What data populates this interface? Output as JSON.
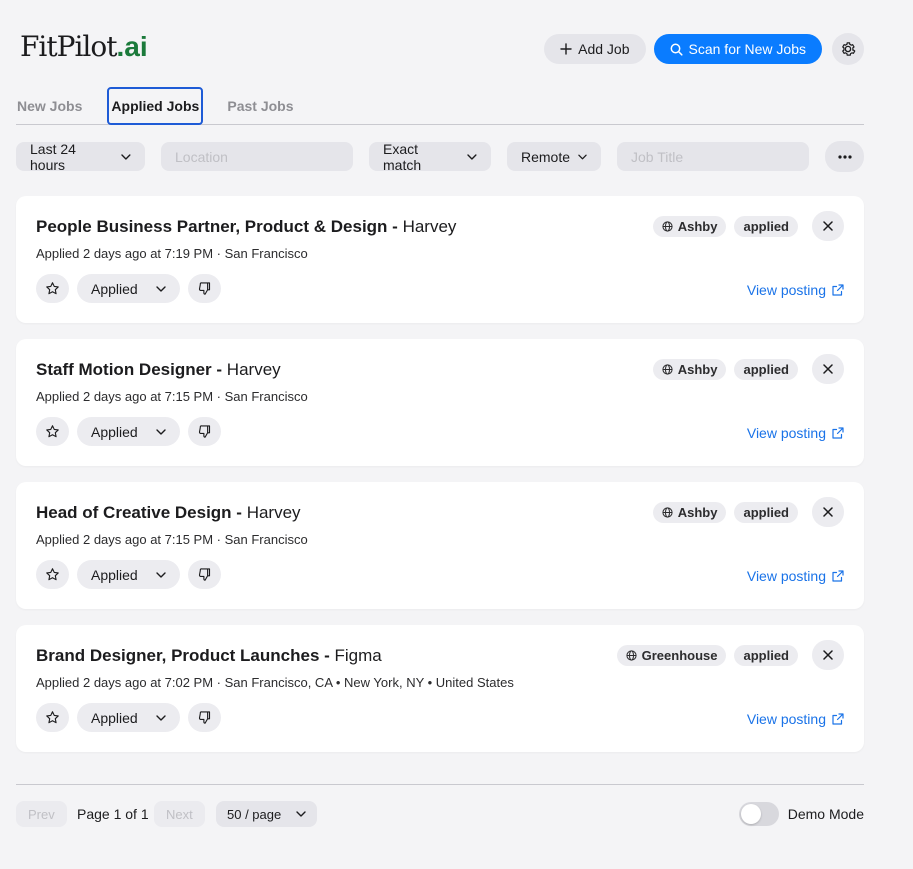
{
  "brand": {
    "name": "FitPilot",
    "suffix": ".ai"
  },
  "header": {
    "add_job_label": "Add Job",
    "scan_label": "Scan for New Jobs",
    "settings_icon": "gear-icon",
    "accent": "#0a7cff"
  },
  "tabs": [
    {
      "label": "New Jobs",
      "active": false
    },
    {
      "label": "Applied Jobs",
      "active": true
    },
    {
      "label": "Past Jobs",
      "active": false
    }
  ],
  "filters": {
    "time_range": "Last 24 hours",
    "location_placeholder": "Location",
    "match_mode": "Exact match",
    "work_type": "Remote",
    "job_title_placeholder": "Job Title"
  },
  "jobs": [
    {
      "role": "People Business Partner, Product & Design -",
      "company": "Harvey",
      "subtitle": "Applied 2 days ago at 7:19 PM · San Francisco",
      "source": "Ashby",
      "status_tag": "applied",
      "status_select": "Applied",
      "link_label": "View posting"
    },
    {
      "role": "Staff Motion Designer -",
      "company": "Harvey",
      "subtitle": "Applied 2 days ago at 7:15 PM · San Francisco",
      "source": "Ashby",
      "status_tag": "applied",
      "status_select": "Applied",
      "link_label": "View posting"
    },
    {
      "role": "Head of Creative Design -",
      "company": "Harvey",
      "subtitle": "Applied 2 days ago at 7:15 PM · San Francisco",
      "source": "Ashby",
      "status_tag": "applied",
      "status_select": "Applied",
      "link_label": "View posting"
    },
    {
      "role": "Brand Designer, Product Launches -",
      "company": "Figma",
      "subtitle": "Applied 2 days ago at 7:02 PM · San Francisco, CA • New York, NY • United States",
      "source": "Greenhouse",
      "status_tag": "applied",
      "status_select": "Applied",
      "link_label": "View posting"
    }
  ],
  "pagination": {
    "prev_label": "Prev",
    "page_text": "Page 1 of 1",
    "next_label": "Next",
    "per_page": "50 / page"
  },
  "demo_mode": {
    "label": "Demo Mode",
    "enabled": false
  }
}
